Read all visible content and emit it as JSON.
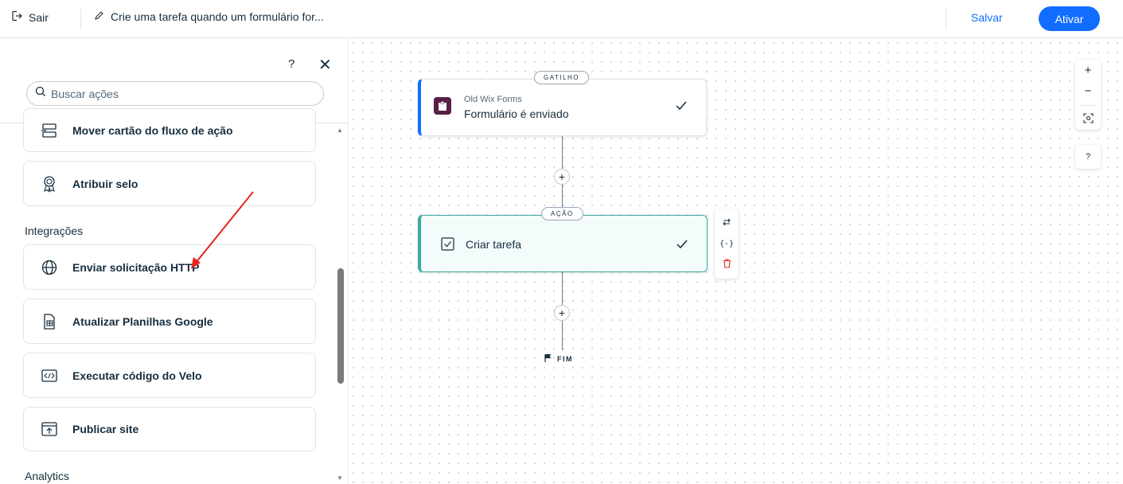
{
  "header": {
    "exit_label": "Sair",
    "title": "Crie uma tarefa quando um formulário for...",
    "save_label": "Salvar",
    "activate_label": "Ativar"
  },
  "sidebar": {
    "help_label": "?",
    "close_label": "✕",
    "search_placeholder": "Buscar ações",
    "items_top": [
      {
        "label": "Mover cartão do fluxo de ação",
        "icon": "move-card-icon"
      },
      {
        "label": "Atribuir selo",
        "icon": "badge-icon"
      }
    ],
    "integrations_title": "Integrações",
    "integrations": [
      {
        "label": "Enviar solicitação HTTP",
        "icon": "globe-icon"
      },
      {
        "label": "Atualizar Planilhas Google",
        "icon": "spreadsheet-icon"
      },
      {
        "label": "Executar código do Velo",
        "icon": "code-icon"
      },
      {
        "label": "Publicar site",
        "icon": "publish-icon"
      }
    ],
    "analytics_title": "Analytics"
  },
  "canvas": {
    "trigger": {
      "pill": "GATILHO",
      "app": "Old Wix Forms",
      "event": "Formulário é enviado"
    },
    "action": {
      "pill": "AÇÃO",
      "label": "Criar tarefa"
    },
    "end_label": "FIM",
    "zoom_in": "+",
    "zoom_out": "−",
    "help": "?"
  },
  "colors": {
    "primary": "#116dff",
    "trigger_accent": "#116dff",
    "action_accent": "#3fa8a0",
    "annotation_arrow": "#e8251c",
    "delete_icon": "#e8251c"
  }
}
